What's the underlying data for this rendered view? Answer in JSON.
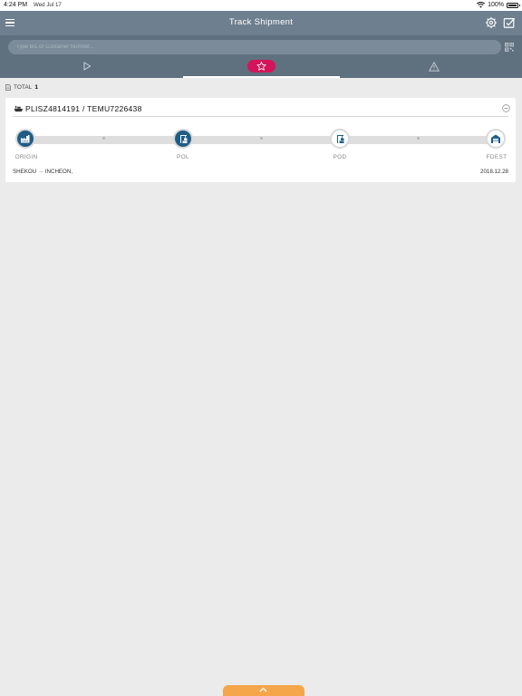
{
  "status_bar": {
    "time": "4:24 PM",
    "date": "Wed Jul 17",
    "battery": "100%"
  },
  "header": {
    "title": "Track Shipment"
  },
  "search": {
    "placeholder": "Type B/L or Container Number..."
  },
  "tabs": [
    {
      "icon": "play-icon",
      "active": false
    },
    {
      "icon": "star-icon",
      "active": true
    },
    {
      "icon": "warning-icon",
      "active": false
    }
  ],
  "summary": {
    "label": "TOTAL",
    "count": "1"
  },
  "shipment": {
    "title": "PLISZ4814191 / TEMU7226438",
    "stages": [
      {
        "label": "ORIGIN",
        "icon": "factory-icon",
        "status": "done"
      },
      {
        "label": "POL",
        "icon": "port-crane-icon",
        "status": "done"
      },
      {
        "label": "POD",
        "icon": "port-crane-icon",
        "status": "pending"
      },
      {
        "label": "FDEST",
        "icon": "warehouse-icon",
        "status": "pending"
      }
    ],
    "route_from": "SHEKOU",
    "route_arrow": "→",
    "route_to": "INCHEON,",
    "date": "2018.12.28"
  },
  "colors": {
    "header": "#6e7f8f",
    "toolbar": "#5f707f",
    "accent_pink": "#d4145a",
    "stage_done": "#1f5d86",
    "pull_tab": "#f5a64a"
  }
}
